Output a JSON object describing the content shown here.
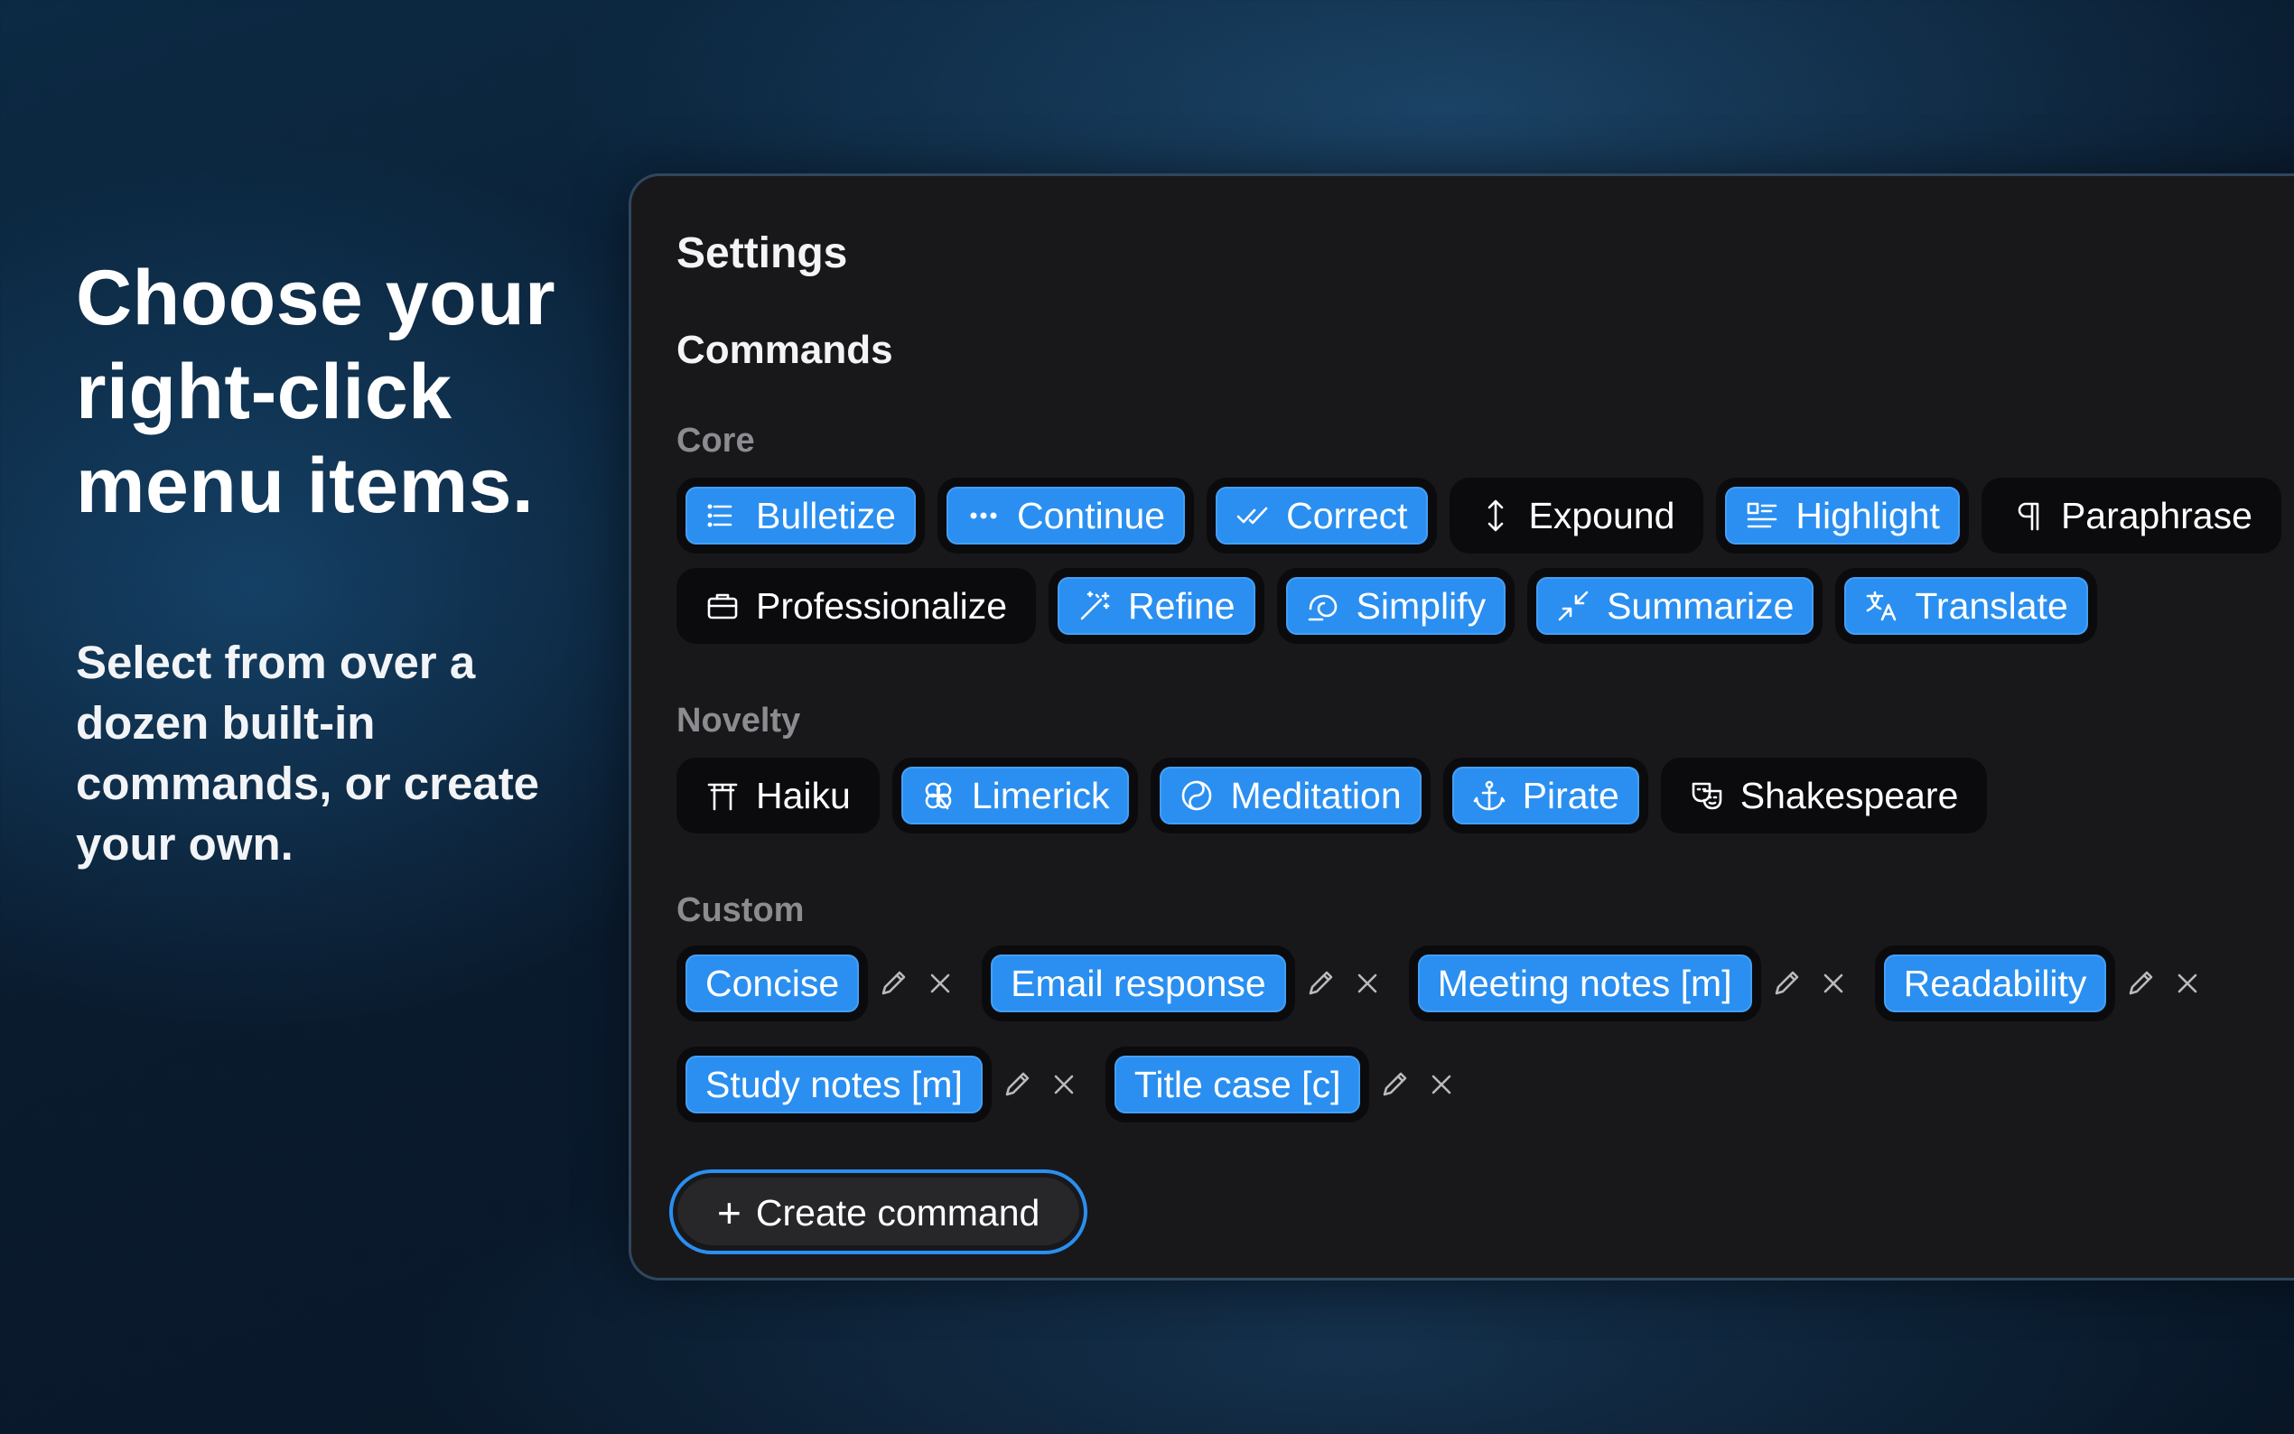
{
  "hero": {
    "headline": "Choose your right-click menu items.",
    "description": "Select from over a dozen built-in commands, or create your own."
  },
  "settings": {
    "title": "Settings",
    "commands_title": "Commands",
    "sections": {
      "core": "Core",
      "novelty": "Novelty",
      "custom": "Custom"
    },
    "core_row1": [
      {
        "label": "Bulletize",
        "icon": "list-icon",
        "enabled": true
      },
      {
        "label": "Continue",
        "icon": "ellipsis-icon",
        "enabled": true
      },
      {
        "label": "Correct",
        "icon": "double-check-icon",
        "enabled": true
      },
      {
        "label": "Expound",
        "icon": "vertical-arrows-icon",
        "enabled": false
      },
      {
        "label": "Highlight",
        "icon": "highlight-list-icon",
        "enabled": true
      },
      {
        "label": "Paraphrase",
        "icon": "pilcrow-icon",
        "enabled": false
      }
    ],
    "core_row2": [
      {
        "label": "Professionalize",
        "icon": "briefcase-icon",
        "enabled": false
      },
      {
        "label": "Refine",
        "icon": "magic-wand-icon",
        "enabled": true
      },
      {
        "label": "Simplify",
        "icon": "swirl-icon",
        "enabled": true
      },
      {
        "label": "Summarize",
        "icon": "shrink-arrows-icon",
        "enabled": true
      },
      {
        "label": "Translate",
        "icon": "translate-icon",
        "enabled": true
      }
    ],
    "novelty": [
      {
        "label": "Haiku",
        "icon": "torii-gate-icon",
        "enabled": false
      },
      {
        "label": "Limerick",
        "icon": "clover-icon",
        "enabled": true
      },
      {
        "label": "Meditation",
        "icon": "yin-yang-icon",
        "enabled": true
      },
      {
        "label": "Pirate",
        "icon": "anchor-icon",
        "enabled": true
      },
      {
        "label": "Shakespeare",
        "icon": "theater-masks-icon",
        "enabled": false
      }
    ],
    "custom_row1": [
      {
        "label": "Concise"
      },
      {
        "label": "Email response"
      },
      {
        "label": "Meeting notes [m]"
      },
      {
        "label": "Readability"
      }
    ],
    "custom_row2": [
      {
        "label": "Study notes [m]"
      },
      {
        "label": "Title case [c]"
      }
    ],
    "create_label": "Create command",
    "colors": {
      "accent": "#2a8ff0",
      "panel": "#18181b",
      "chip_bg": "#0b0b0d"
    }
  }
}
